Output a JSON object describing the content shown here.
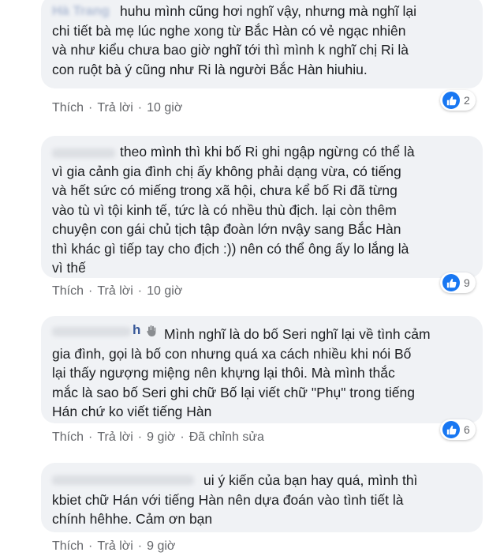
{
  "comments": [
    {
      "author": "Hà Trang",
      "text": "huhu mình cũng hơi nghĩ vậy, nhưng mà nghĩ lại\nchi tiết bà mẹ lúc nghe xong từ Bắc Hàn có vẻ ngạc nhiên\nvà như kiểu chưa bao giờ nghĩ tới thì mình k nghĩ chị Ri là\ncon ruột bà ý cũng như Ri là người Bắc Hàn hiuhiu.",
      "actions": {
        "like": "Thích",
        "reply": "Trả lời",
        "time": "10 giờ"
      },
      "reaction_count": "2"
    },
    {
      "author": "",
      "text": "theo mình thì khi bố Ri ghi ngập ngừng có thể là\nvì gia cảnh gia đình chị ấy không phải dạng vừa, có tiếng\nvà hết sức có miếng trong xã hội, chưa kể bố Ri đã từng\nvào tù vì tội kinh tế, tức là có nhều thù địch. lại còn thêm\nchuyện con gái chủ tịch tập đoàn lớn nvậy sang Bắc Hàn\nthì khác gì tiếp tay cho địch :)) nên có thể ông ấy lo lắng là\nvì thế",
      "actions": {
        "like": "Thích",
        "reply": "Trả lời",
        "time": "10 giờ"
      },
      "reaction_count": "9"
    },
    {
      "author": "h",
      "text": "Mình nghĩ là do bố Seri nghĩ lại về tình cảm\ngia đình, gọi là bố con nhưng quá xa cách nhiều khi nói Bố\nlại thấy ngượng miệng nên khựng lại thôi. Mà mình thắc\nmắc là sao bố Seri ghi chữ Bố lại viết chữ \"Phụ\" trong tiếng\nHán chứ ko viết tiếng Hàn",
      "actions": {
        "like": "Thích",
        "reply": "Trả lời",
        "time": "9 giờ",
        "edited": "Đã chỉnh sửa"
      },
      "reaction_count": "6"
    },
    {
      "author": "",
      "text": "ui ý kiến của bạn hay quá, mình thì\nkbiet chữ Hán với tiếng Hàn nên dựa đoán vào tình tiết là\nchính hêhhe. Cảm ơn bạn",
      "actions": {
        "like": "Thích",
        "reply": "Trả lời",
        "time": "9 giờ"
      }
    }
  ],
  "colors": {
    "bubble": "#f0f2f5",
    "like_blue": "#1877f2",
    "meta_gray": "#65676b"
  },
  "icons": {
    "reaction": "like-thumb-icon",
    "wave": "waving-hand-icon"
  }
}
